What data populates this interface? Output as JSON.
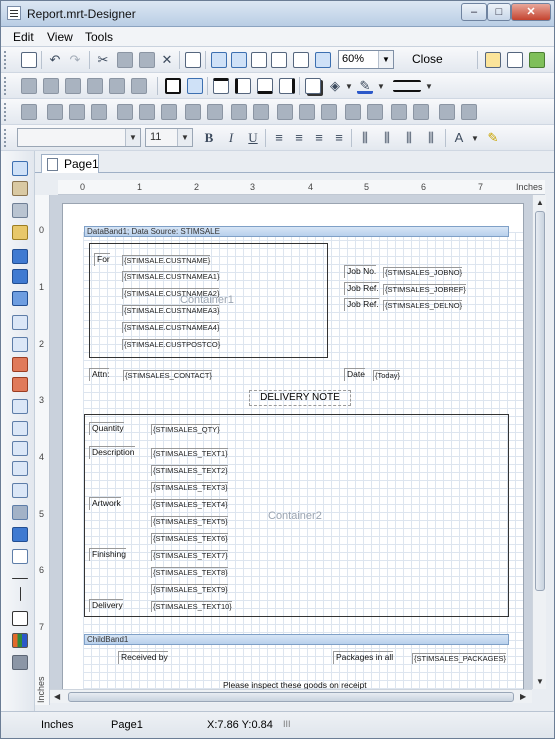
{
  "window": {
    "title": "Report.mrt-Designer",
    "minimize": "–",
    "maximize": "□",
    "close": "✕"
  },
  "menu": {
    "edit": "Edit",
    "view": "View",
    "tools": "Tools"
  },
  "toolbar": {
    "zoom": "60%",
    "close_label": "Close"
  },
  "format_toolbar": {
    "font_name": "",
    "font_size": "11",
    "bold": "B",
    "italic": "I",
    "underline": "U",
    "font_color": "A"
  },
  "tabs": [
    {
      "label": "Page1"
    }
  ],
  "ruler": {
    "unit": "Inches",
    "h_ticks": [
      "0",
      "1",
      "2",
      "3",
      "4",
      "5",
      "6",
      "7"
    ],
    "v_ticks": [
      "0",
      "1",
      "2",
      "3",
      "4",
      "5",
      "6",
      "7"
    ],
    "v_unit": "Inches"
  },
  "report": {
    "databand_header": "DataBand1; Data Source: STIMSALE",
    "childband_header": "ChildBand1",
    "container1": "Container1",
    "container2": "Container2",
    "for_label": "For",
    "cust_fields": [
      "{STIMSALE.CUSTNAME}",
      "{STIMSALE.CUSTNAMEA1}",
      "{STIMSALE.CUSTNAMEA2}",
      "{STIMSALE.CUSTNAMEA3}",
      "{STIMSALE.CUSTNAMEA4}",
      "{STIMSALE.CUSTPOSTCO}"
    ],
    "job_labels": [
      "Job No.",
      "Job Ref.",
      "Job Ref."
    ],
    "job_fields": [
      "{STIMSALES_JOBNO}",
      "{STIMSALES_JOBREF}",
      "{STIMSALES_DELNO}"
    ],
    "attn_label": "Attn:",
    "contact_field": "{STIMSALES_CONTACT}",
    "date_label": "Date",
    "today_field": "{Today}",
    "delivery_note": "DELIVERY  NOTE",
    "quantity_label": "Quantity",
    "qty_field": "{STIMSALES_QTY}",
    "row_labels": [
      "Description",
      "Artwork",
      "Finishing",
      "Delivery"
    ],
    "text_fields": [
      "{STIMSALES_TEXT1}",
      "{STIMSALES_TEXT2}",
      "{STIMSALES_TEXT3}",
      "{STIMSALES_TEXT4}",
      "{STIMSALES_TEXT5}",
      "{STIMSALES_TEXT6}",
      "{STIMSALES_TEXT7}",
      "{STIMSALES_TEXT8}",
      "{STIMSALES_TEXT9}",
      "{STIMSALES_TEXT10}"
    ],
    "received_by": "Received by",
    "packages_label": "Packages in all",
    "packages_field": "{STIMSALES_PACKAGES}",
    "footer_note": "Please inspect these goods on receipt"
  },
  "status": {
    "units": "Inches",
    "page": "Page1",
    "coords": "X:7.86  Y:0.84",
    "grip": "III"
  }
}
